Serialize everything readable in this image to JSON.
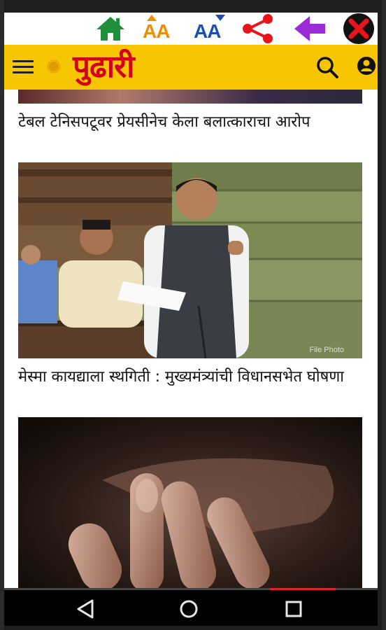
{
  "toolbar": {
    "font_increase_label": "AA",
    "font_decrease_label": "AA",
    "colors": {
      "home": "#1f8f3a",
      "font_up": "#f08c00",
      "font_down": "#1a4fb8",
      "share": "#e8141a",
      "back": "#9b2bd6",
      "close": "#e8141a"
    }
  },
  "header": {
    "brand": "पुढारी",
    "background_color": "#f8c600",
    "brand_color": "#d4001a"
  },
  "articles": [
    {
      "headline": "टेबल टेनिसपटूवर प्रेयसीनेच केला बलात्काराचा आरोप"
    },
    {
      "headline": "मेस्मा कायद्याला स्थगिती : मुख्यमंत्र्यांची विधानसभेत घोषणा",
      "photo_credit": "File Photo"
    }
  ]
}
